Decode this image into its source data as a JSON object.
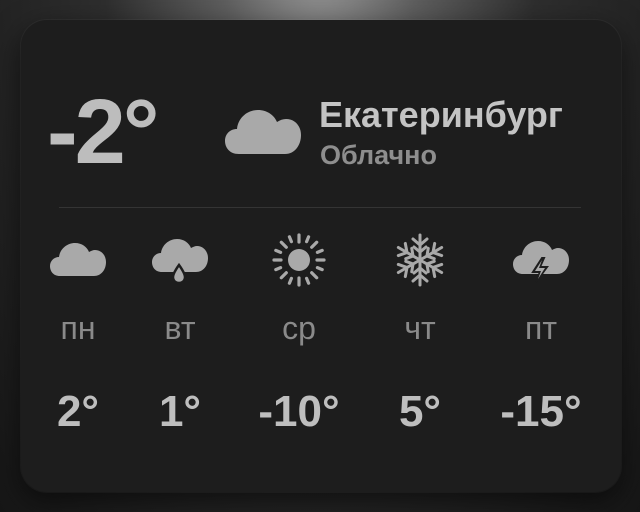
{
  "current": {
    "temperature": "-2°",
    "icon": "cloud-icon",
    "city": "Екатеринбург",
    "condition": "Облачно"
  },
  "forecast": [
    {
      "day": "пн",
      "temp": "2°",
      "icon": "cloud-icon"
    },
    {
      "day": "вт",
      "temp": "1°",
      "icon": "cloud-rain-drop-icon"
    },
    {
      "day": "ср",
      "temp": "-10°",
      "icon": "sun-icon"
    },
    {
      "day": "чт",
      "temp": "5°",
      "icon": "snowflake-icon"
    },
    {
      "day": "пт",
      "temp": "-15°",
      "icon": "cloud-lightning-icon"
    }
  ],
  "colors": {
    "widget_background": "#1d1d1d",
    "primary_text": "#bdbdbd",
    "secondary_text": "#8e8e8e",
    "icon": "#a8a8a8"
  }
}
